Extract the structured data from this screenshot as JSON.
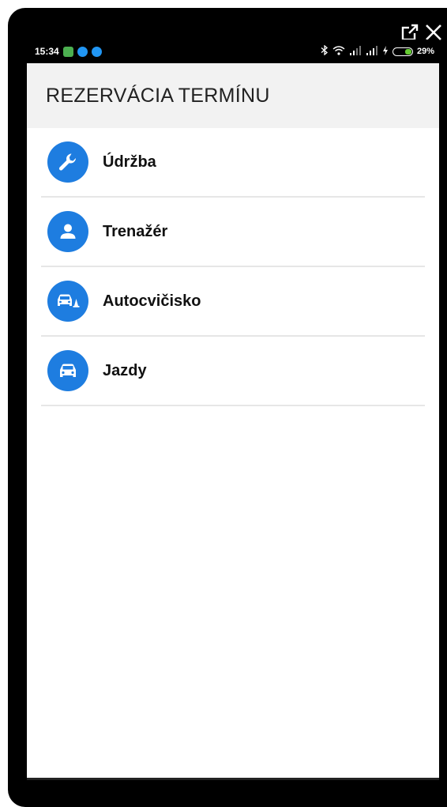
{
  "statusbar": {
    "time": "15:34",
    "battery": "29%"
  },
  "appbar": {
    "title": "REZERVÁCIA TERMÍNU"
  },
  "menu": {
    "items": [
      {
        "label": "Údržba",
        "icon": "wrench-icon"
      },
      {
        "label": "Trenažér",
        "icon": "person-icon"
      },
      {
        "label": "Autocvičisko",
        "icon": "car-cone-icon"
      },
      {
        "label": "Jazdy",
        "icon": "car-icon"
      }
    ]
  },
  "colors": {
    "accent": "#1e7de0",
    "appbar_bg": "#f2f2f2",
    "divider": "#e6e6e6"
  }
}
